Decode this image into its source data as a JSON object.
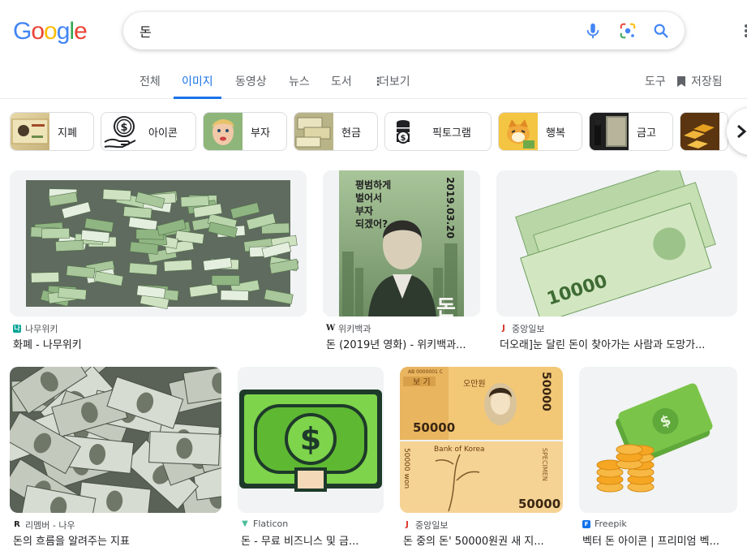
{
  "logo": {
    "letters": [
      {
        "ch": "G",
        "color": "#4285F4"
      },
      {
        "ch": "o",
        "color": "#EA4335"
      },
      {
        "ch": "o",
        "color": "#FBBC05"
      },
      {
        "ch": "g",
        "color": "#4285F4"
      },
      {
        "ch": "l",
        "color": "#34A853"
      },
      {
        "ch": "e",
        "color": "#EA4335"
      }
    ]
  },
  "search": {
    "query": "돈",
    "icons": [
      "microphone-icon",
      "google-lens-icon",
      "search-icon"
    ]
  },
  "tabs": [
    {
      "label": "전체",
      "active": false
    },
    {
      "label": "이미지",
      "active": true
    },
    {
      "label": "동영상",
      "active": false
    },
    {
      "label": "뉴스",
      "active": false
    },
    {
      "label": "도서",
      "active": false
    },
    {
      "label": "더보기",
      "active": false
    }
  ],
  "tools": {
    "label": "도구",
    "saved_label": "저장됨"
  },
  "chips": [
    {
      "label": "지폐",
      "icon": "banknote-thumb"
    },
    {
      "label": "아이콘",
      "icon": "money-hand-icon"
    },
    {
      "label": "부자",
      "icon": "rich-face-thumb"
    },
    {
      "label": "현금",
      "icon": "cash-thumb"
    },
    {
      "label": "픽토그램",
      "icon": "coin-stack-icon"
    },
    {
      "label": "행복",
      "icon": "happy-dog-thumb"
    },
    {
      "label": "금고",
      "icon": "vault-thumb"
    },
    {
      "label": "",
      "icon": "gold-bars-thumb"
    }
  ],
  "results": [
    {
      "source": "나무위키",
      "title": "화폐 - 나무위키",
      "favicon": "namu-favicon",
      "favicon_color": "#00a495"
    },
    {
      "source": "위키백과",
      "title": "돈 (2019년 영화) - 위키백과...",
      "favicon": "wikipedia-favicon",
      "favicon_color": "#202124"
    },
    {
      "source": "중앙일보",
      "title": "더오래]눈 달린 돈이 찾아가는 사람과 도망가...",
      "favicon": "joongang-favicon",
      "favicon_color": "#d93025"
    },
    {
      "source": "리멤버 - 나우",
      "title": "돈의 흐름을 알려주는 지표",
      "favicon": "remember-favicon",
      "favicon_color": "#202124"
    },
    {
      "source": "Flaticon",
      "title": "돈 - 무료 비즈니스 및 금...",
      "favicon": "flaticon-favicon",
      "favicon_color": "#4dbd9a"
    },
    {
      "source": "중앙일보",
      "title": "돈 중의 돈' 50000원권 새 지...",
      "favicon": "joongang-favicon",
      "favicon_color": "#d93025"
    },
    {
      "source": "Freepik",
      "title": "벡터 돈 아이콘 | 프리미엄 벡...",
      "favicon": "freepik-favicon",
      "favicon_color": "#1273eb"
    }
  ],
  "image_text": {
    "movie_poster_lines": [
      "평범하게",
      "벌어서",
      "부자",
      "되겠어?"
    ],
    "movie_poster_date": "2019.03.20",
    "movie_poster_title": "돈",
    "banknote_value": "10000",
    "korean_note_label": "보 기",
    "korean_note_name": "오만원",
    "korean_note_value": "50000",
    "korean_note_bank": "Bank of Korea",
    "korean_note_specimen": "SPECIMEN",
    "korean_note_won": "50000 won",
    "korean_note_serial": "AB 0000001 C"
  },
  "colors": {
    "accent": "#1a73e8",
    "tab_text": "#5f6368",
    "banknote_green": "#7fbf5a",
    "icon_green": "#7ed44b",
    "coin_orange": "#f5a623"
  }
}
